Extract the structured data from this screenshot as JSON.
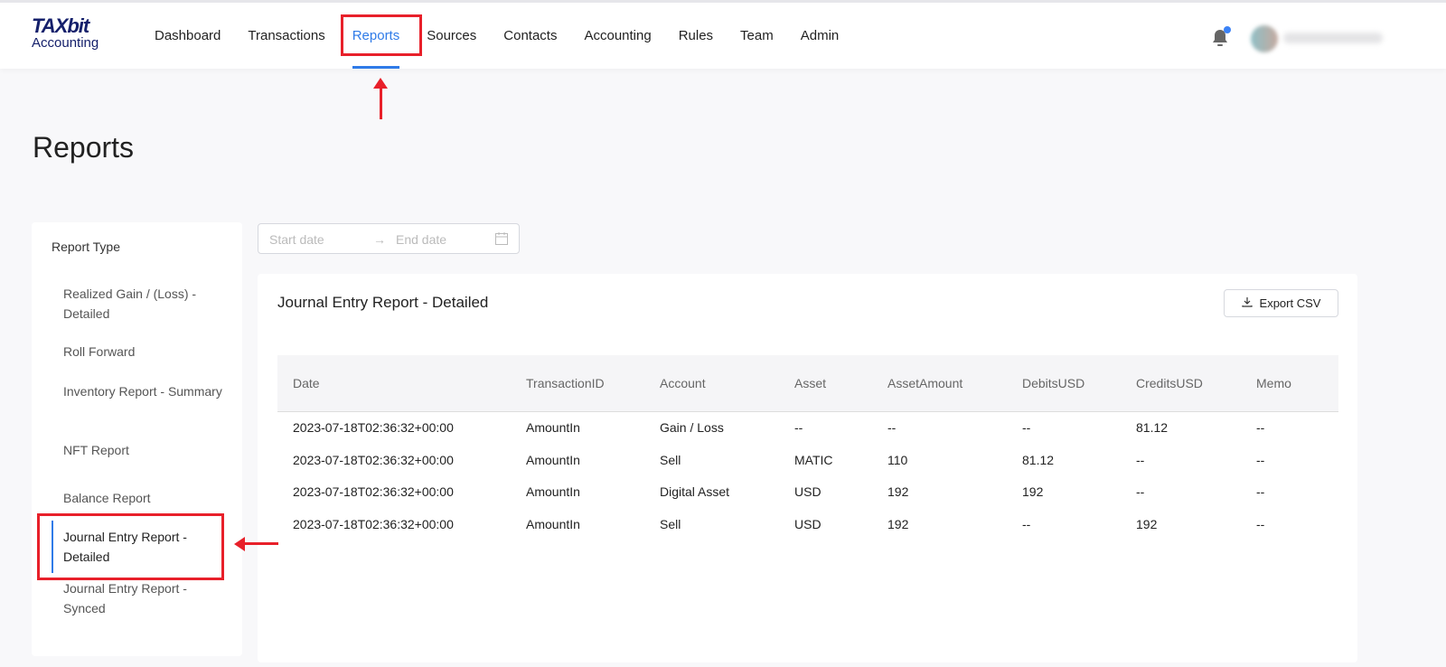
{
  "logo": {
    "top": "TAXbit",
    "bottom": "Accounting"
  },
  "nav": [
    "Dashboard",
    "Transactions",
    "Reports",
    "Sources",
    "Contacts",
    "Accounting",
    "Rules",
    "Team",
    "Admin"
  ],
  "page_title": "Reports",
  "sidebar": {
    "title": "Report Type",
    "items": [
      "Realized Gain / (Loss) - Detailed",
      "Roll Forward",
      "Inventory Report - Summary",
      "NFT Report",
      "Balance Report",
      "Journal Entry Report - Detailed",
      "Journal Entry Report - Synced"
    ]
  },
  "date": {
    "start": "Start date",
    "end": "End date"
  },
  "report": {
    "title": "Journal Entry Report - Detailed",
    "export": "Export CSV",
    "columns": [
      "Date",
      "TransactionID",
      "Account",
      "Asset",
      "AssetAmount",
      "DebitsUSD",
      "CreditsUSD",
      "Memo"
    ],
    "rows": [
      [
        "2023-07-18T02:36:32+00:00",
        "AmountIn",
        "Gain / Loss",
        "--",
        "--",
        "--",
        "81.12",
        "--"
      ],
      [
        "2023-07-18T02:36:32+00:00",
        "AmountIn",
        "Sell",
        "MATIC",
        "110",
        "81.12",
        "--",
        "--"
      ],
      [
        "2023-07-18T02:36:32+00:00",
        "AmountIn",
        "Digital Asset",
        "USD",
        "192",
        "192",
        "--",
        "--"
      ],
      [
        "2023-07-18T02:36:32+00:00",
        "AmountIn",
        "Sell",
        "USD",
        "192",
        "--",
        "192",
        "--"
      ]
    ]
  },
  "colors": {
    "accent": "#2f7be8",
    "annotation": "#e8202a",
    "brand": "#15206b"
  }
}
